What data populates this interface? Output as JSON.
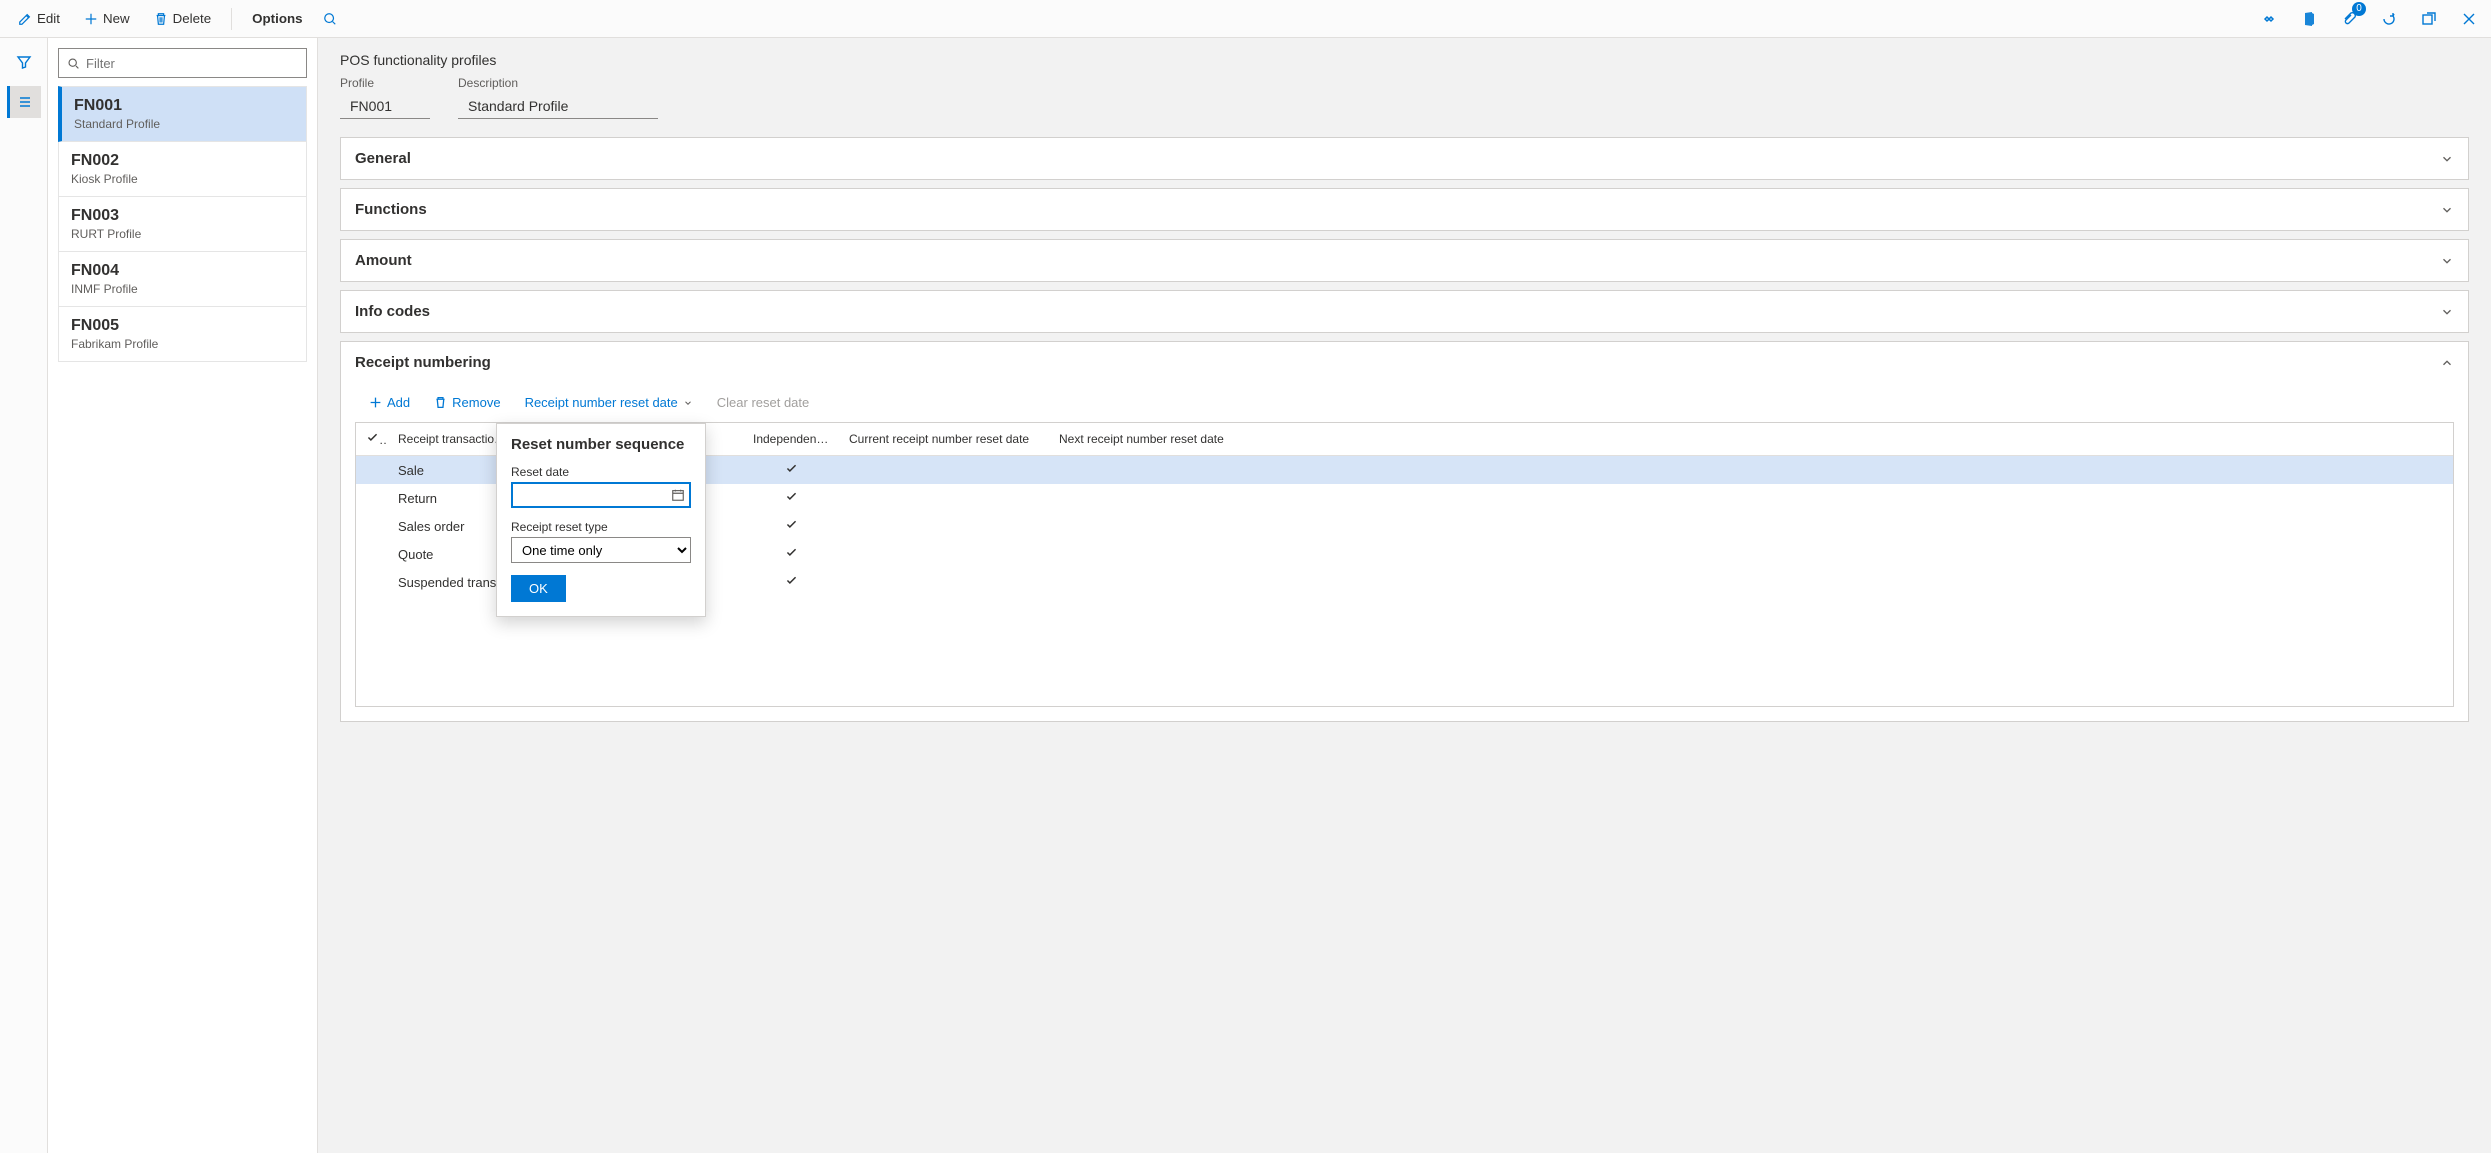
{
  "topbar": {
    "edit": "Edit",
    "new_": "New",
    "delete_": "Delete",
    "options": "Options",
    "badge_count": "0"
  },
  "sidebar": {
    "filter_placeholder": "Filter",
    "items": [
      {
        "code": "FN001",
        "desc": "Standard Profile",
        "selected": true
      },
      {
        "code": "FN002",
        "desc": "Kiosk Profile",
        "selected": false
      },
      {
        "code": "FN003",
        "desc": "RURT Profile",
        "selected": false
      },
      {
        "code": "FN004",
        "desc": "INMF Profile",
        "selected": false
      },
      {
        "code": "FN005",
        "desc": "Fabrikam Profile",
        "selected": false
      }
    ]
  },
  "page": {
    "title": "POS functionality profiles",
    "profile_label": "Profile",
    "profile_value": "FN001",
    "description_label": "Description",
    "description_value": "Standard Profile"
  },
  "sections": {
    "general": "General",
    "functions": "Functions",
    "amount": "Amount",
    "info_codes": "Info codes",
    "receipt_numbering": "Receipt numbering"
  },
  "grid_toolbar": {
    "add": "Add",
    "remove": "Remove",
    "reset_date_menu": "Receipt number reset date",
    "clear_reset": "Clear reset date"
  },
  "grid": {
    "columns": {
      "type": "Receipt transaction type",
      "independent": "Independent se...",
      "current_reset": "Current receipt number reset date",
      "next_reset": "Next receipt number reset date"
    },
    "rows": [
      {
        "type": "Sale",
        "independent": true,
        "selected": true
      },
      {
        "type": "Return",
        "independent": true,
        "selected": false
      },
      {
        "type": "Sales order",
        "independent": true,
        "selected": false
      },
      {
        "type": "Quote",
        "independent": true,
        "selected": false
      },
      {
        "type": "Suspended transa",
        "independent": true,
        "selected": false
      }
    ]
  },
  "popup": {
    "title": "Reset number sequence",
    "reset_date_label": "Reset date",
    "reset_date_value": "",
    "reset_type_label": "Receipt reset type",
    "reset_type_value": "One time only",
    "ok": "OK"
  }
}
